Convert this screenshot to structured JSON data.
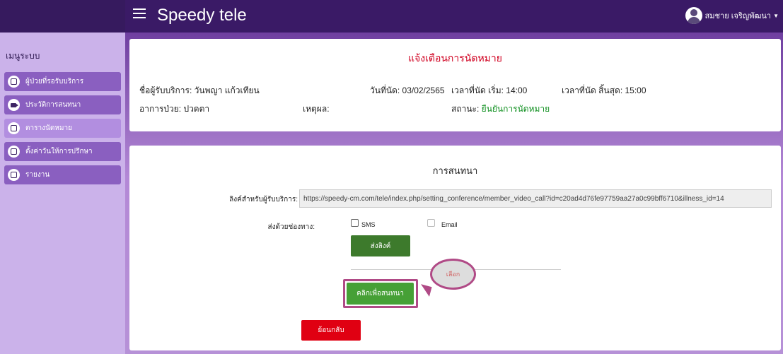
{
  "header": {
    "brand": "Speedy tele",
    "user_name": "สมชาย เจริญพัฒนา"
  },
  "sidebar": {
    "title": "เมนูระบบ",
    "items": [
      {
        "label": "ผู้ป่วยที่รอรับบริการ",
        "icon": "monitor-icon"
      },
      {
        "label": "ประวัติการสนทนา",
        "icon": "video-camera-icon"
      },
      {
        "label": "ตารางนัดหมาย",
        "icon": "table-icon"
      },
      {
        "label": "ตั้งค่าวันให้การปรึกษา",
        "icon": "calendar-plus-icon"
      },
      {
        "label": "รายงาน",
        "icon": "document-icon"
      }
    ]
  },
  "appointment": {
    "title": "แจ้งเตือนการนัดหมาย",
    "patient": "ชื่อผู้รับบริการ: วันพญา แก้วเทียน",
    "date": "วันที่นัด: 03/02/2565",
    "start_time": "เวลาที่นัด เริ่ม: 14:00",
    "end_time": "เวลาที่นัด สิ้นสุด: 15:00",
    "symptom": "อาการป่วย: ปวดตา",
    "reason": "เหตุผล:",
    "status_label": "สถานะ:",
    "status_value": "ยืนยันการนัดหมาย"
  },
  "conversation": {
    "title": "การสนทนา",
    "link_label": "ลิงค์สำหรับผู้รับบริการ:",
    "link_value": "https://speedy-cm.com/tele/index.php/setting_conference/member_video_call?id=c20ad4d76fe97759aa27a0c99bff6710&illness_id=14",
    "send_via_label": "ส่งด้วยช่องทาง:",
    "option_sms": "SMS",
    "option_email": "Email",
    "send_button": "ส่งลิงค์",
    "call_button": "คลิกเพื่อสนทนา",
    "callout": "เลือก",
    "back_button": "ย้อนกลับ"
  },
  "colors": {
    "header": "#3a1a66",
    "sidebar": "#cbb2ea",
    "menu_item": "#8a5fc0",
    "menu_item_active": "#b28ee0",
    "alert_title": "#d00020",
    "status_ok": "#109020",
    "send_button": "#3d7a2c",
    "call_button": "#46a036",
    "back_button": "#e00012",
    "highlight": "#b04a86"
  }
}
